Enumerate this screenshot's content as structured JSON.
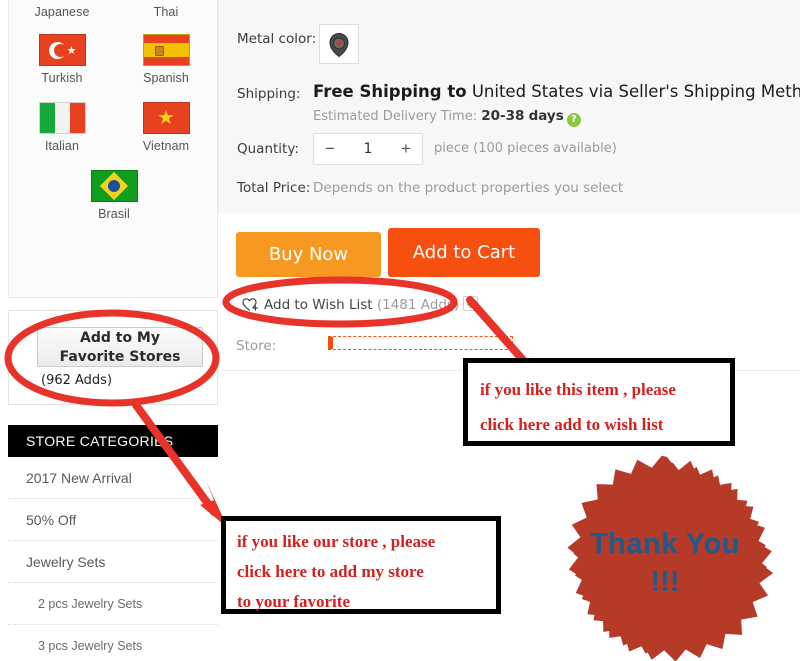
{
  "sidebar": {
    "languages": [
      {
        "name": "Japanese",
        "flag": "jp-flag-icon",
        "row": 0,
        "col": 0,
        "name_only": true
      },
      {
        "name": "Thai",
        "flag": "th-flag-icon",
        "row": 0,
        "col": 1,
        "name_only": true
      },
      {
        "name": "Turkish",
        "flag": "tr-flag-icon",
        "row": 1,
        "col": 0
      },
      {
        "name": "Spanish",
        "flag": "es-flag-icon",
        "row": 1,
        "col": 1
      },
      {
        "name": "Italian",
        "flag": "it-flag-icon",
        "row": 2,
        "col": 0
      },
      {
        "name": "Vietnam",
        "flag": "vn-flag-icon",
        "row": 2,
        "col": 1
      },
      {
        "name": "Brasil",
        "flag": "br-flag-icon",
        "row": 3,
        "col": 0
      }
    ],
    "favorite": {
      "button_label_line1": "Add to My",
      "button_label_line2": "Favorite Stores",
      "adds_count": "(962 Adds)"
    },
    "categories_header": "STORE CATEGORIES",
    "categories": [
      {
        "label": "2017 New Arrival",
        "sub": false
      },
      {
        "label": "50% Off",
        "sub": false
      },
      {
        "label": "Jewelry Sets",
        "sub": false
      },
      {
        "label": "2 pcs Jewelry Sets",
        "sub": true
      },
      {
        "label": "3 pcs Jewelry Sets",
        "sub": true
      }
    ]
  },
  "product": {
    "metal_color_label": "Metal color:",
    "metal_color_swatch": "pendant-thumbnail",
    "shipping_label": "Shipping:",
    "shipping_free_prefix": "Free Shipping to",
    "shipping_destination": "United States via Seller's Shipping Method",
    "shipping_dropdown_icon": "chevron-down-icon",
    "estimated_label": "Estimated Delivery Time:",
    "estimated_value": "20-38",
    "estimated_unit": "days",
    "help_icon": "question-mark-icon",
    "quantity_label": "Quantity:",
    "quantity_minus": "−",
    "quantity_value": "1",
    "quantity_plus": "+",
    "quantity_hint": "piece (100 pieces available)",
    "total_price_label": "Total Price:",
    "total_price_hint": "Depends on the product properties you select",
    "buy_now_label": "Buy Now",
    "add_to_cart_label": "Add to Cart",
    "wish_list_label": "Add to Wish List",
    "wish_list_count": "(1481 Adds)",
    "wish_heart_icon": "heart-plus-icon",
    "wish_dropdown_icon": "chevron-down-icon",
    "store_label": "Store:"
  },
  "annotations": {
    "wish_note": {
      "line1": "if  you like this item , please",
      "line2": "click here add to wish list"
    },
    "store_note": {
      "line1": "if  you like our store , please",
      "line2": "click here to add my store",
      "line3": "to your favorite"
    },
    "thanks": {
      "line1": "Thank You",
      "line2": "!!!"
    },
    "shapes": {
      "ellipse_favorite": "red-ellipse-highlight",
      "ellipse_wishlist": "red-ellipse-highlight",
      "arrow_to_store": "red-arrow-icon",
      "arrow_to_wish_note": "red-arrow-icon",
      "starburst": "orange-starburst-badge"
    }
  },
  "colors": {
    "annotation_red": "#d42020",
    "buy_now_orange": "#f79821",
    "add_cart_orange": "#f5500f",
    "starburst_fill": "#f5a142",
    "starburst_shadow": "#b53a28",
    "thanks_text": "#1f5a8c",
    "help_green": "#8cc63e"
  }
}
